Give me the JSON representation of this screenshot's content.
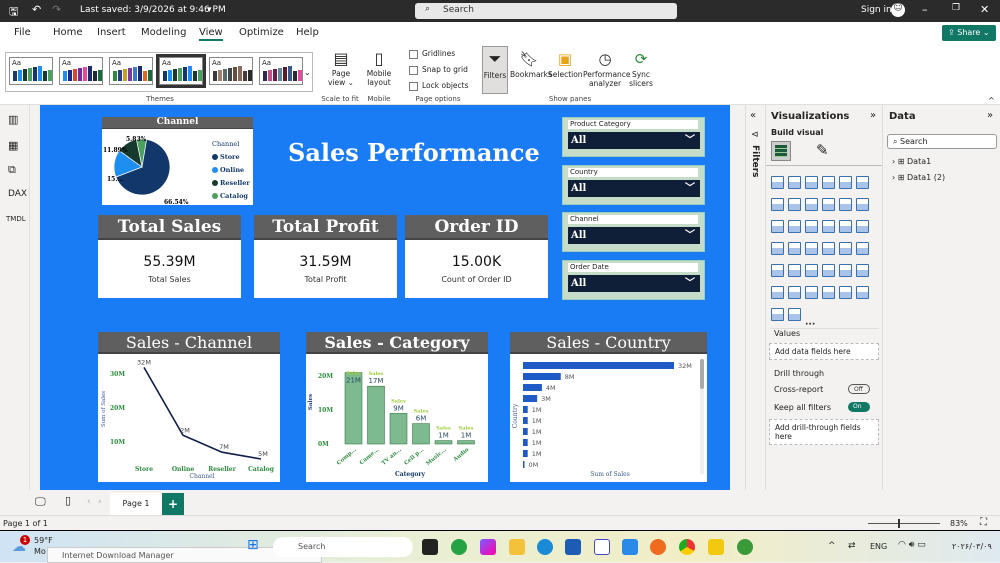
{
  "titlebar": {
    "last_saved": "Last saved: 3/9/2026 at 9:46 PM",
    "search_placeholder": "Search",
    "sign_in": "Sign in"
  },
  "menu": {
    "tabs": [
      "File",
      "Home",
      "Insert",
      "Modeling",
      "View",
      "Optimize",
      "Help"
    ],
    "active": "View",
    "share": "Share"
  },
  "ribbon": {
    "themes_label": "Themes",
    "themes": [
      [
        "#1b3a6b",
        "#1f8ef1",
        "#163a2e",
        "#4aa05e",
        "#12386b",
        "#1f8ef1",
        "#163a2e",
        "#4aa05e"
      ],
      [
        "#1f8ef1",
        "#1b2a8a",
        "#e0442e",
        "#7a2a9a",
        "#e34ba0",
        "#1b2a6b",
        "#1b2a3b",
        "#1a6b3b"
      ],
      [
        "#2b8a3b",
        "#2b3a8a",
        "#c8a020",
        "#7a3aa0",
        "#3a7ad0",
        "#1b2a6b",
        "#e06a20",
        "#1a6b3b"
      ],
      [
        "#12386b",
        "#1f8ef1",
        "#163a2e",
        "#4aa05e",
        "#12386b",
        "#1f8ef1",
        "#163a2e",
        "#4aa05e"
      ],
      [
        "#3a3a3a",
        "#a08070",
        "#5a6a6a",
        "#3a4a4a",
        "#6a4a3a",
        "#8a6a5a",
        "#4a3a3a",
        "#2a2a2a"
      ],
      [
        "#2b2b4b",
        "#c8508a",
        "#6a1a4a",
        "#5a8aa0",
        "#5a1a2a",
        "#3a5a8a",
        "#2a2a3a",
        "#e34ba0"
      ]
    ],
    "page_view": "Page view",
    "scale_to_fit": "Scale to fit",
    "mobile_layout": "Mobile layout",
    "mobile": "Mobile",
    "gridlines": "Gridlines",
    "snap_to_grid": "Snap to grid",
    "lock_objects": "Lock objects",
    "page_options": "Page options",
    "filters": "Filters",
    "bookmarks": "Bookmarks",
    "selection": "Selection",
    "performance_analyzer": "Performance analyzer",
    "sync_slicers": "Sync slicers",
    "show_panes": "Show panes"
  },
  "report": {
    "title": "Sales Performance",
    "cards": [
      {
        "header": "Total Sales",
        "value": "55.39M",
        "label": "Total Sales"
      },
      {
        "header": "Total Profit",
        "value": "31.59M",
        "label": "Total Profit"
      },
      {
        "header": "Order ID",
        "value": "15.00K",
        "label": "Count of Order ID"
      }
    ],
    "slicers": [
      {
        "label": "Product Category",
        "value": "All"
      },
      {
        "label": "Country",
        "value": "All"
      },
      {
        "label": "Channel",
        "value": "All"
      },
      {
        "label": "Order Date",
        "value": "All"
      }
    ]
  },
  "chart_data": [
    {
      "type": "pie",
      "title": "Channel",
      "legend_title": "Channel",
      "legend": "right",
      "categories": [
        "Store",
        "Online",
        "Reseller",
        "Catalog"
      ],
      "values": [
        66.54,
        15.74,
        11.89,
        5.83
      ],
      "data_labels": [
        "66.54%",
        "15....",
        "11.89%",
        "5.83%"
      ],
      "colors": [
        "#12386b",
        "#1f8ef1",
        "#163a2e",
        "#4aa05e"
      ]
    },
    {
      "type": "line",
      "title": "Sales - Channel",
      "xlabel": "Channel",
      "ylabel": "Sum of Sales",
      "categories": [
        "Store",
        "Online",
        "Reseller",
        "Catalog"
      ],
      "values": [
        32,
        12,
        7,
        5
      ],
      "data_labels": [
        "32M",
        "2M",
        "7M",
        "5M"
      ],
      "yticks": [
        "10M",
        "20M",
        "30M"
      ],
      "ytick_values": [
        10,
        20,
        30
      ],
      "ylim": [
        5,
        33
      ],
      "color": "#0f1f4a"
    },
    {
      "type": "bar",
      "title": "Sales - Category",
      "xlabel": "Category",
      "ylabel": "Sales",
      "categories": [
        "Comp...",
        "Came...",
        "TV an...",
        "Cell p...",
        "Music...",
        "Audio"
      ],
      "values": [
        21,
        17,
        9,
        6,
        1,
        1
      ],
      "data_labels": [
        "21M",
        "17M",
        "9M",
        "6M",
        "1M",
        "1M"
      ],
      "series_label": "Sales",
      "yticks": [
        "0M",
        "10M",
        "20M"
      ],
      "ytick_values": [
        0,
        10,
        20
      ],
      "ylim": [
        0,
        23
      ],
      "color": "#7dba8f"
    },
    {
      "type": "bar",
      "orientation": "horizontal",
      "title": "Sales - Country",
      "xlabel": "Sum of Sales",
      "ylabel": "Country",
      "values": [
        32,
        8,
        4,
        3,
        1,
        1,
        1,
        1,
        1,
        0
      ],
      "data_labels": [
        "32M",
        "8M",
        "4M",
        "3M",
        "1M",
        "1M",
        "1M",
        "1M",
        "1M",
        "0M"
      ],
      "color": "#1e5bc6"
    }
  ],
  "panes": {
    "filters": "Filters",
    "visualizations": "Visualizations",
    "build_visual": "Build visual",
    "values": "Values",
    "add_data_fields": "Add data fields here",
    "drill_through": "Drill through",
    "cross_report": "Cross-report",
    "cross_report_state": "Off",
    "keep_all_filters": "Keep all filters",
    "keep_all_filters_state": "On",
    "add_drill_through": "Add drill-through fields here",
    "data": "Data",
    "data_search": "Search",
    "tables": [
      "Data1",
      "Data1 (2)"
    ]
  },
  "bottom": {
    "page_tab": "Page 1",
    "page_status": "Page 1 of 1",
    "zoom": "83%"
  },
  "taskbar": {
    "weather": "59°F",
    "weather_sub": "Mo",
    "badge": "1",
    "search": "Search",
    "idm_popup": "Internet Download Manager",
    "lang": "ENG",
    "clock": "۲۰۲۶/۰۳/۰۹"
  }
}
